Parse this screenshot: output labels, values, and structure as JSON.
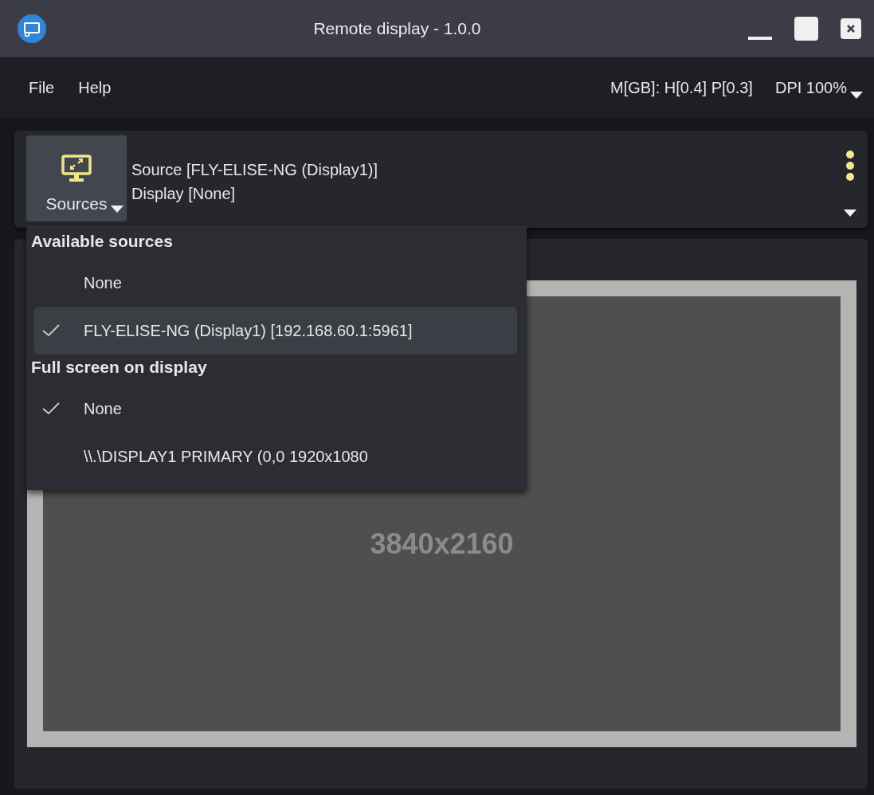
{
  "window": {
    "title": "Remote display - 1.0.0"
  },
  "menu": [
    "File",
    "Help"
  ],
  "status": {
    "memory": "M[GB]: H[0.4] P[0.3]",
    "dpi": "DPI 100%"
  },
  "toolbar": {
    "button_label": "Sources",
    "source": "Source [FLY-ELISE-NG (Display1)]",
    "display": "Display [None]"
  },
  "dropdown": {
    "sections": [
      {
        "heading": "Available sources",
        "items": [
          {
            "label": "None",
            "checked": false,
            "selected": false
          },
          {
            "label": "FLY-ELISE-NG (Display1) [192.168.60.1:5961]",
            "checked": true,
            "selected": true
          }
        ]
      },
      {
        "heading": "Full screen on display",
        "items": [
          {
            "label": "None",
            "checked": true,
            "selected": false
          },
          {
            "label": "\\\\.\\DISPLAY1 PRIMARY (0,0 1920x1080",
            "checked": false,
            "selected": false
          }
        ]
      }
    ]
  },
  "preview": {
    "resolution": "3840x2160"
  }
}
